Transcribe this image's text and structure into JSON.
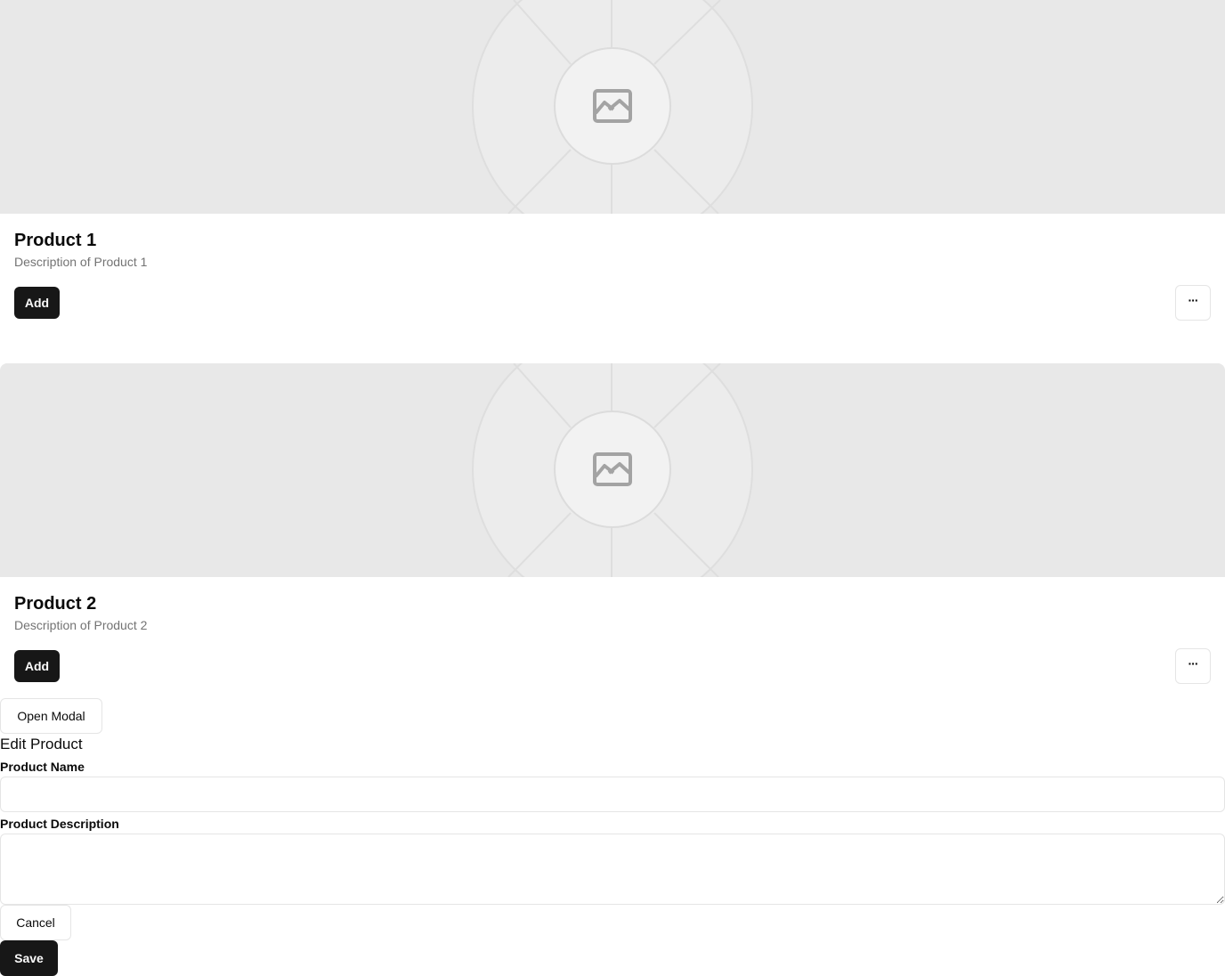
{
  "products": [
    {
      "title": "Product 1",
      "description": "Description of Product 1",
      "add_label": "Add",
      "more_label": "···",
      "image_icon": "image-placeholder-icon"
    },
    {
      "title": "Product 2",
      "description": "Description of Product 2",
      "add_label": "Add",
      "more_label": "···",
      "image_icon": "image-placeholder-icon"
    }
  ],
  "open_modal_label": "Open Modal",
  "modal": {
    "title": "Edit Product",
    "name_label": "Product Name",
    "name_value": "",
    "description_label": "Product Description",
    "description_value": "",
    "cancel_label": "Cancel",
    "save_label": "Save"
  },
  "colors": {
    "primary": "#171717",
    "primary_text": "#fafafa",
    "border": "#e5e5e5",
    "muted_text": "#737373",
    "placeholder_bg": "#e8e8e8"
  }
}
